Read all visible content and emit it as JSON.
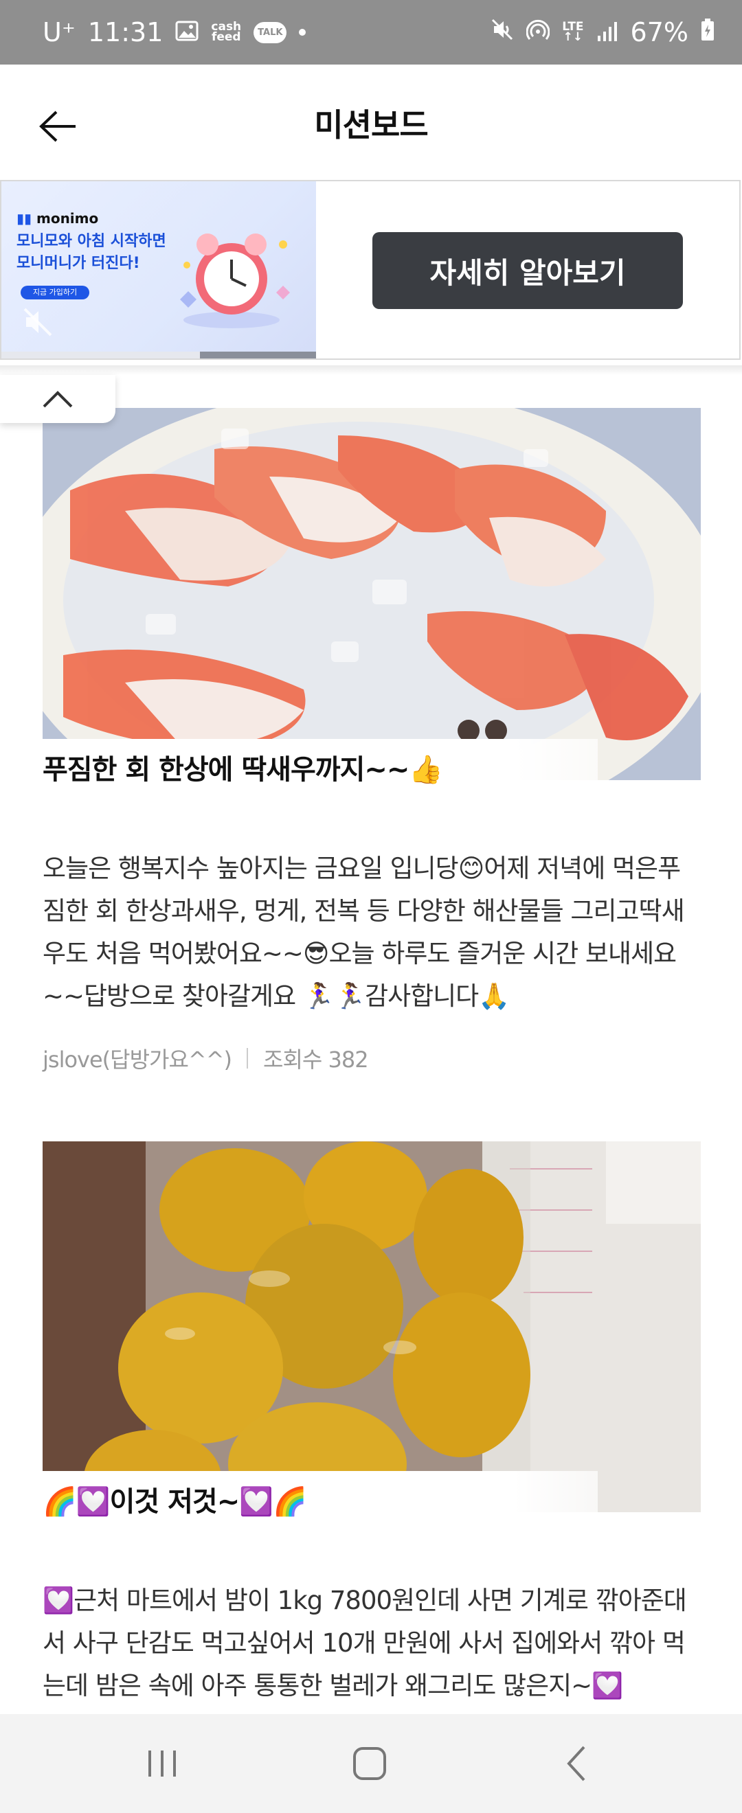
{
  "status_bar": {
    "carrier": "U⁺",
    "time": "11:31",
    "cashfeed_line1": "cash",
    "cashfeed_line2": "feed",
    "talk": "TALK",
    "lte_line1": "LTE",
    "lte_line2": "↑↓",
    "battery": "67%"
  },
  "header": {
    "title": "미션보드"
  },
  "ad": {
    "brand": "monimo",
    "headline_line1": "모니모와 아침 시작하면",
    "headline_line2": "모니머니가 터진다!",
    "pill": "지금 가입하기",
    "cta": "자세히 알아보기",
    "video_progress": 0.63
  },
  "posts": [
    {
      "title": "푸짐한 회 한상에 딱새우까지~~👍",
      "body": "오늘은 행복지수 높아지는 금요일 입니당😊어제 저녁에 먹은푸짐한 회 한상과새우, 멍게, 전복 등 다양한 해산물들 그리고딱새우도 처음 먹어봤어요~~😎오늘 하루도 즐거운 시간 보내세요~~답방으로 찾아갈게요 🏃‍♀️🏃‍♀️감사합니다🙏",
      "author": "jslove(답방가요^^)",
      "views": "조회수 382"
    },
    {
      "title": "🌈💟이것 저것~💟🌈",
      "body": "💟근처 마트에서 밤이 1kg 7800원인데 사면 기계로 깎아준대서 사구 단감도 먹고싶어서 10개 만원에 사서 집에와서 깎아 먹는데 밤은 속에 아주 통통한 벌레가 왜그리도 많은지~💟"
    }
  ],
  "colors": {
    "status_bar": "#8f8f8f",
    "cta_button": "#3a3d42",
    "ad_accent": "#1a4fd8",
    "meta_text": "#999999"
  }
}
